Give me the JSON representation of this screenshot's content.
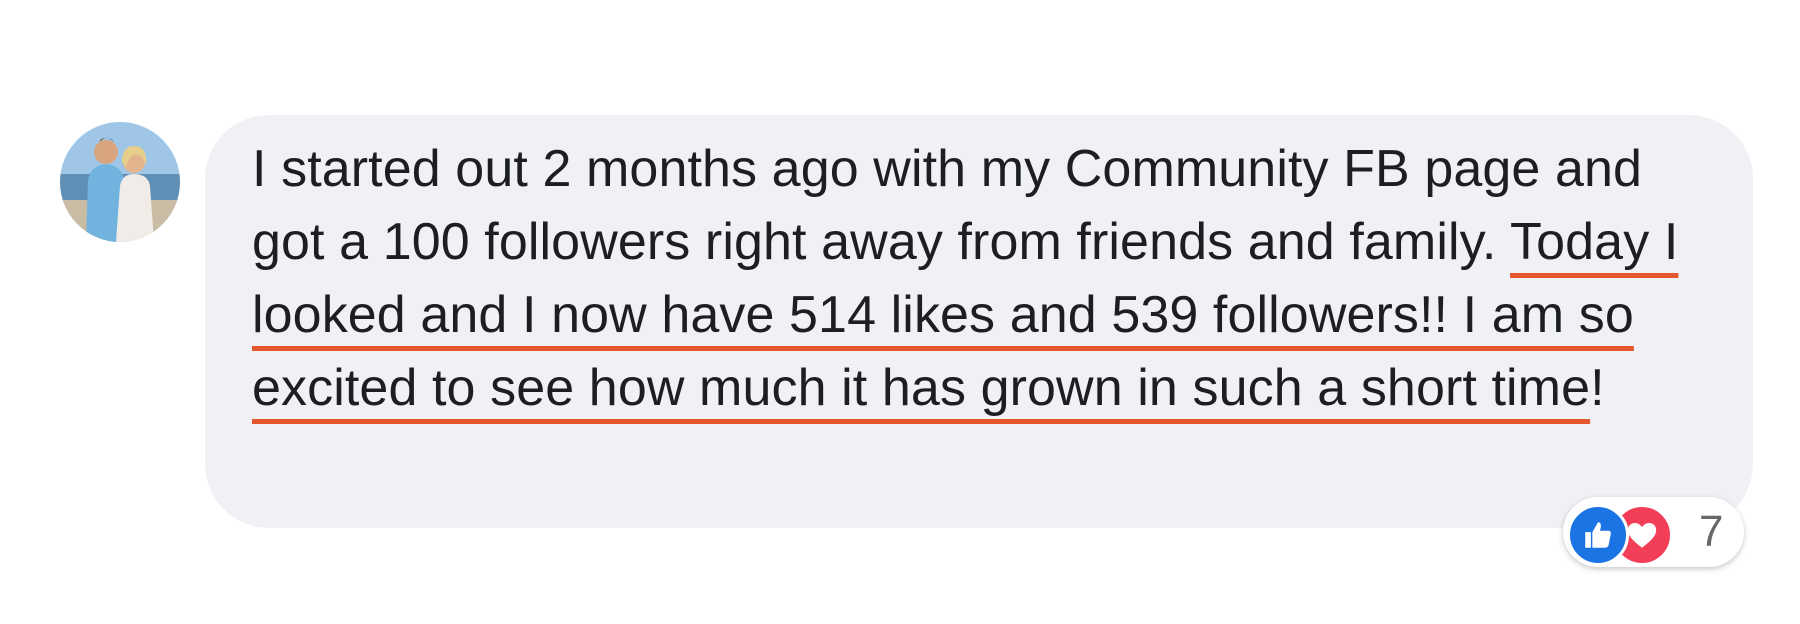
{
  "comment": {
    "text_before": "I started out 2 months ago with my Community FB page and got a 100 followers right away from friends and family. ",
    "text_highlighted": "Today I looked and I now have 514 likes and 539 followers!! I am so excited to see how much it has grown in such a short time",
    "text_after": "!"
  },
  "reactions": {
    "count": "7",
    "types": [
      "like-icon",
      "heart-icon"
    ]
  },
  "colors": {
    "bubble": "#f0f1f5",
    "text": "#1c1e21",
    "underline": "#e4572e",
    "like": "#1b74e4",
    "love": "#f33e58",
    "count": "#65676b"
  }
}
